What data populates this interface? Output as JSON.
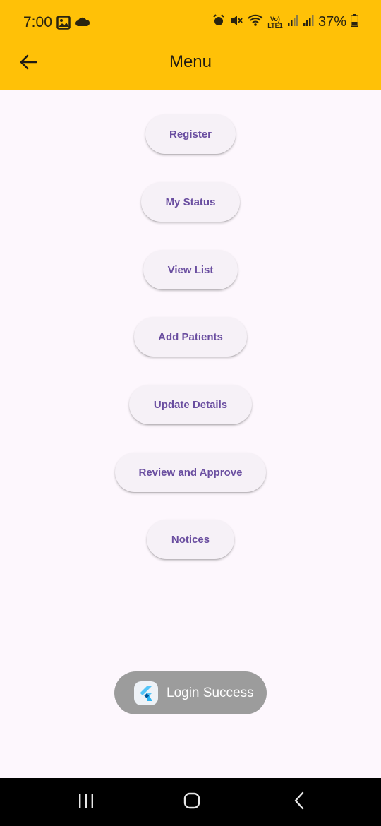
{
  "status_bar": {
    "time": "7:00",
    "battery": "37%",
    "left_icons": [
      "image-icon",
      "cloud-icon"
    ],
    "right_icons": [
      "alarm-icon",
      "mute-icon",
      "wifi-call-icon",
      "volte-icon",
      "signal-icon",
      "signal-icon",
      "battery-icon"
    ],
    "volte_label": "Vo) LTE1"
  },
  "appbar": {
    "title": "Menu",
    "back_icon": "arrow-left-icon",
    "color": "#ffc107"
  },
  "menu": {
    "items": [
      {
        "label": "Register"
      },
      {
        "label": "My Status"
      },
      {
        "label": "View List"
      },
      {
        "label": "Add Patients"
      },
      {
        "label": "Update Details"
      },
      {
        "label": "Review and Approve"
      },
      {
        "label": "Notices"
      }
    ],
    "text_color": "#6a4ea0"
  },
  "toast": {
    "text": "Login Success",
    "icon": "flutter-logo-icon"
  },
  "navbar": {
    "items": [
      "recent-apps-icon",
      "home-icon",
      "back-icon"
    ]
  }
}
